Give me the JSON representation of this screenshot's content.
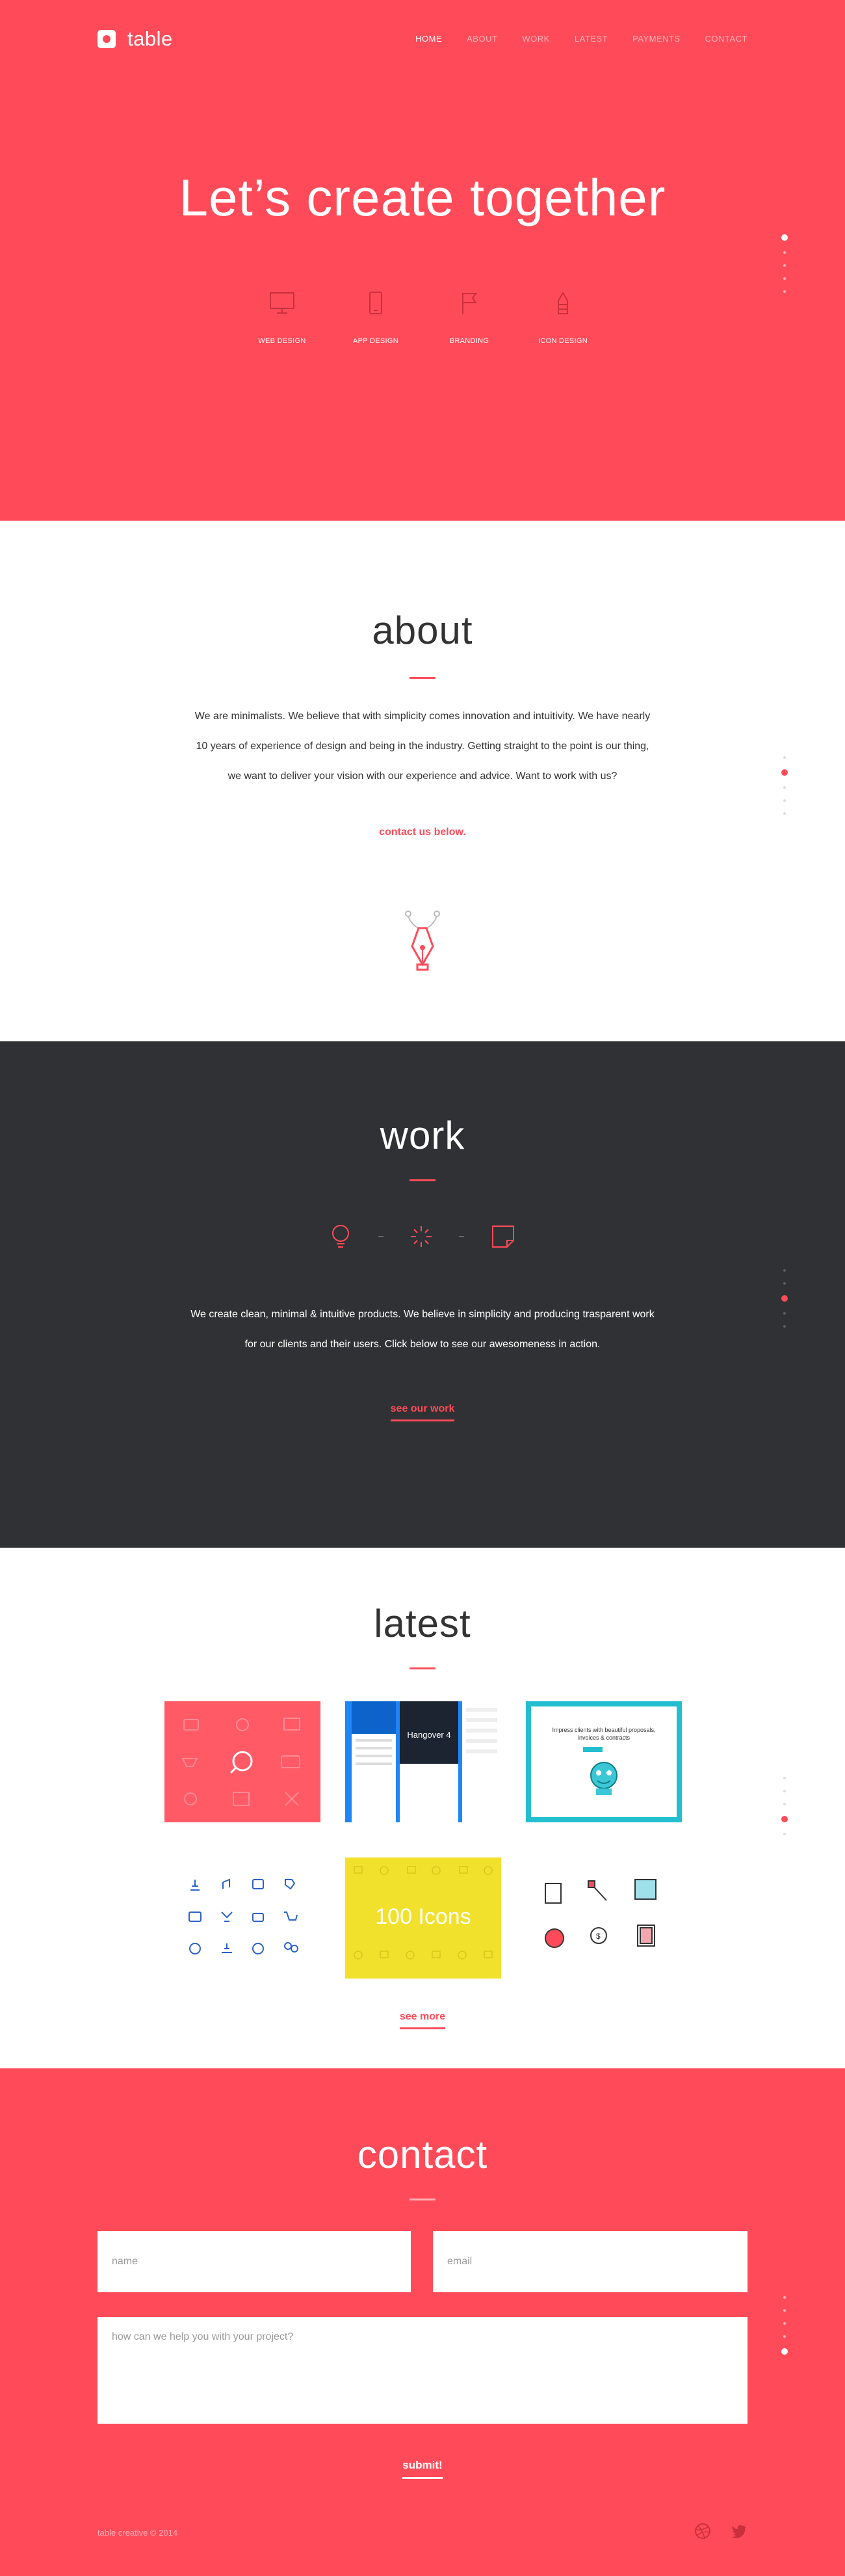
{
  "brand": {
    "name": "table"
  },
  "nav": {
    "items": [
      "HOME",
      "ABOUT",
      "WORK",
      "LATEST",
      "PAYMENTS",
      "CONTACT"
    ]
  },
  "hero": {
    "title": "Let’s create together",
    "services": [
      {
        "label": "WEB DESIGN",
        "icon": "monitor-icon"
      },
      {
        "label": "APP DESIGN",
        "icon": "phone-icon"
      },
      {
        "label": "BRANDING",
        "icon": "flag-icon"
      },
      {
        "label": "ICON DESIGN",
        "icon": "pencil-icon"
      }
    ]
  },
  "about": {
    "title": "about",
    "lines": [
      "We are minimalists. We believe that with simplicity comes innovation and intuitivity. We have nearly",
      "10 years of experience of design and being in the industry. Getting straight to the point is our thing,",
      "we want to deliver your vision with our experience and advice. Want to work with us?"
    ],
    "link": "contact us below."
  },
  "work": {
    "title": "work",
    "lines": [
      "We create clean, minimal & intuitive products. We believe in simplicity and producing trasparent work",
      "for our clients and their users. Click below to see our awesomeness in action."
    ],
    "link": "see our work"
  },
  "latest": {
    "title": "latest",
    "tiles": {
      "hangover_title": "Hangover 4",
      "impress_text": "Impress clients with beautiful proposals, invoices & contracts",
      "icons_text": "100 Icons"
    },
    "link": "see more"
  },
  "contact": {
    "title": "contact",
    "name_placeholder": "name",
    "email_placeholder": "email",
    "message_placeholder": "how can we help you with your project?",
    "submit": "submit!",
    "copyright": "table creative © 2014"
  },
  "colors": {
    "accent": "#ff4b59",
    "dark": "#303134",
    "cyan": "#24bfcf",
    "blue": "#1f86f5",
    "yellow": "#f2e12c"
  }
}
